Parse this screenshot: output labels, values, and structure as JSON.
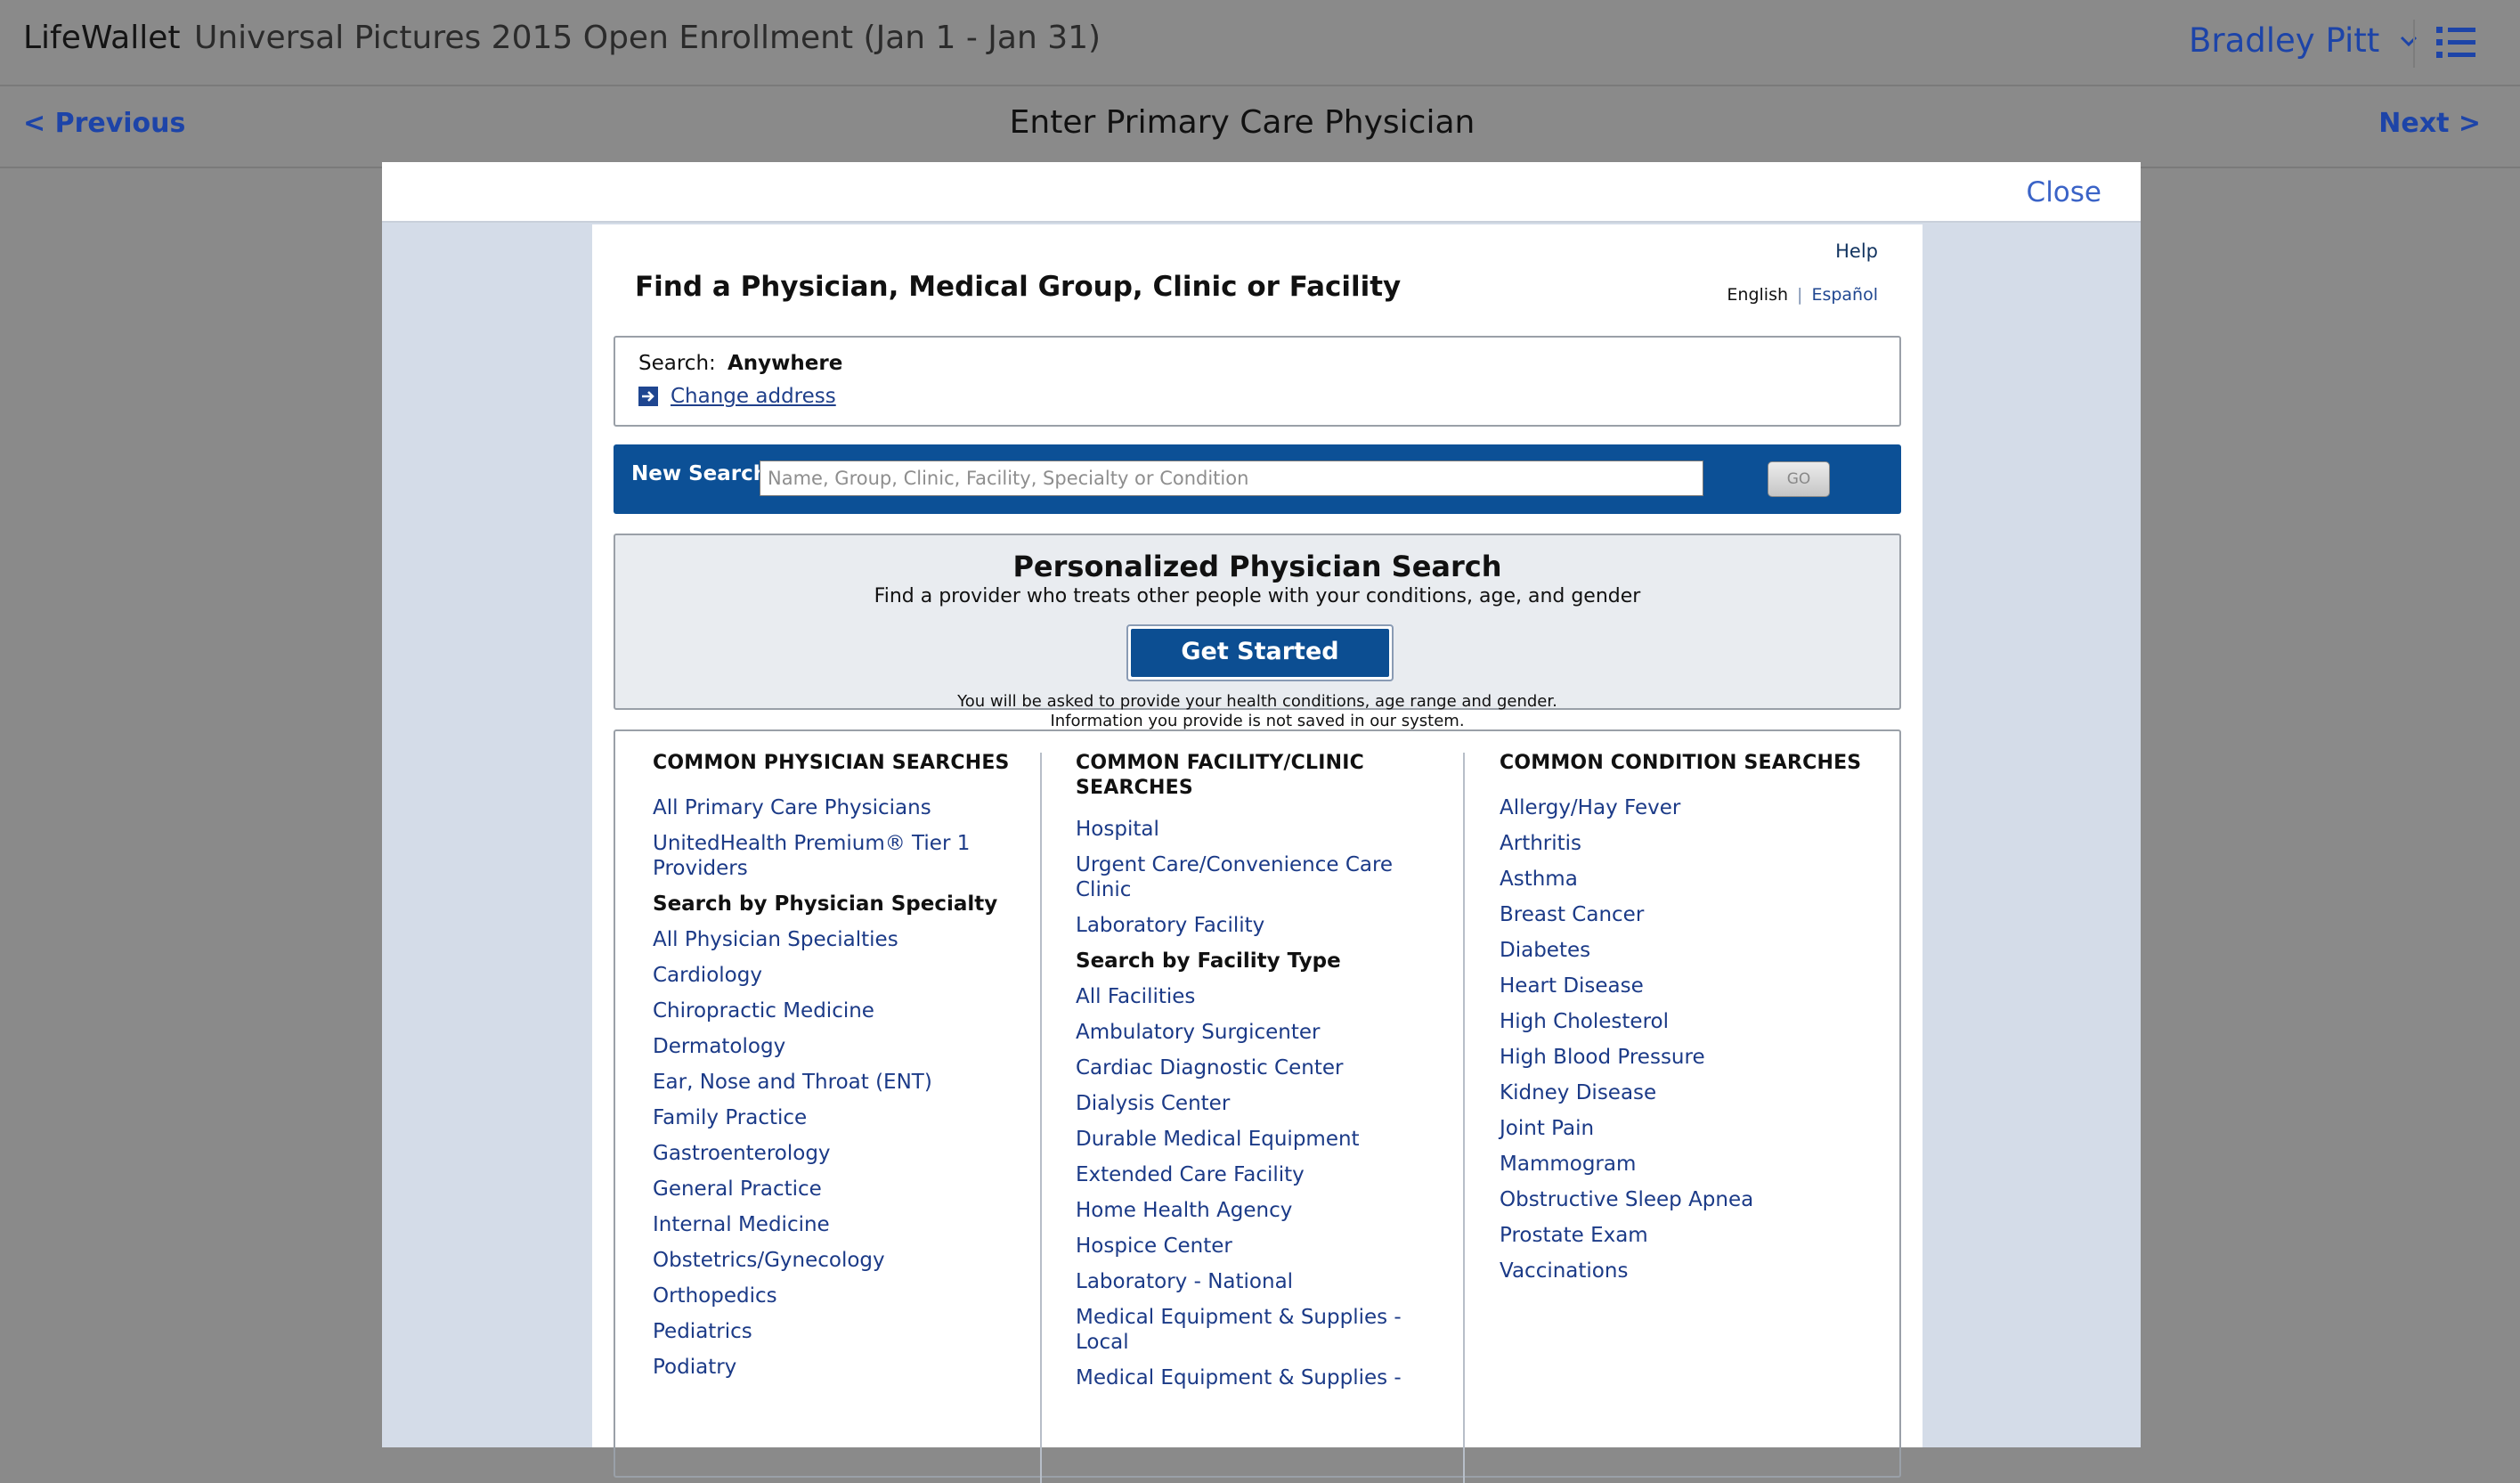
{
  "app": {
    "name": "LifeWallet",
    "enrollment_title": "Universal Pictures 2015 Open Enrollment (Jan 1 - Jan 31)",
    "user_name": "Bradley Pitt"
  },
  "nav": {
    "previous": "< Previous",
    "title": "Enter Primary Care Physician",
    "next": "Next >"
  },
  "modal": {
    "close": "Close"
  },
  "finder": {
    "help": "Help",
    "title": "Find a Physician, Medical Group, Clinic or Facility",
    "lang_english": "English",
    "lang_spanish": "Español",
    "search_label": "Search:",
    "search_value": "Anywhere",
    "change_address": "Change address",
    "new_search_label": "New Search",
    "search_placeholder": "Name, Group, Clinic, Facility, Specialty or Condition",
    "go_label": "GO"
  },
  "personalized": {
    "title": "Personalized Physician Search",
    "subtitle": "Find a provider who treats other people with your conditions, age, and gender",
    "button": "Get Started",
    "note_line1": "You will be asked to provide your health conditions, age range and gender.",
    "note_line2": "Information you provide is not saved in our system."
  },
  "physician_searches": {
    "heading": "COMMON PHYSICIAN SEARCHES",
    "items": [
      "All Primary Care Physicians",
      "UnitedHealth Premium® Tier 1 Providers",
      "Search by Physician Specialty",
      "All Physician Specialties",
      "Cardiology",
      "Chiropractic Medicine",
      "Dermatology",
      "Ear, Nose and Throat (ENT)",
      "Family Practice",
      "Gastroenterology",
      "General Practice",
      "Internal Medicine",
      "Obstetrics/Gynecology",
      "Orthopedics",
      "Pediatrics",
      "Podiatry"
    ]
  },
  "facility_searches": {
    "heading": "COMMON FACILITY/CLINIC SEARCHES",
    "items": [
      "Hospital",
      "Urgent Care/Convenience Care Clinic",
      "Laboratory Facility",
      "Search by Facility Type",
      "All Facilities",
      "Ambulatory Surgicenter",
      "Cardiac Diagnostic Center",
      "Dialysis Center",
      "Durable Medical Equipment",
      "Extended Care Facility",
      "Home Health Agency",
      "Hospice Center",
      "Laboratory - National",
      "Medical Equipment & Supplies - Local",
      "Medical Equipment & Supplies -"
    ]
  },
  "condition_searches": {
    "heading": "COMMON CONDITION SEARCHES",
    "items": [
      "Allergy/Hay Fever",
      "Arthritis",
      "Asthma",
      "Breast Cancer",
      "Diabetes",
      "Heart Disease",
      "High Cholesterol",
      "High Blood Pressure",
      "Kidney Disease",
      "Joint Pain",
      "Mammogram",
      "Obstructive Sleep Apnea",
      "Prostate Exam",
      "Vaccinations"
    ]
  }
}
